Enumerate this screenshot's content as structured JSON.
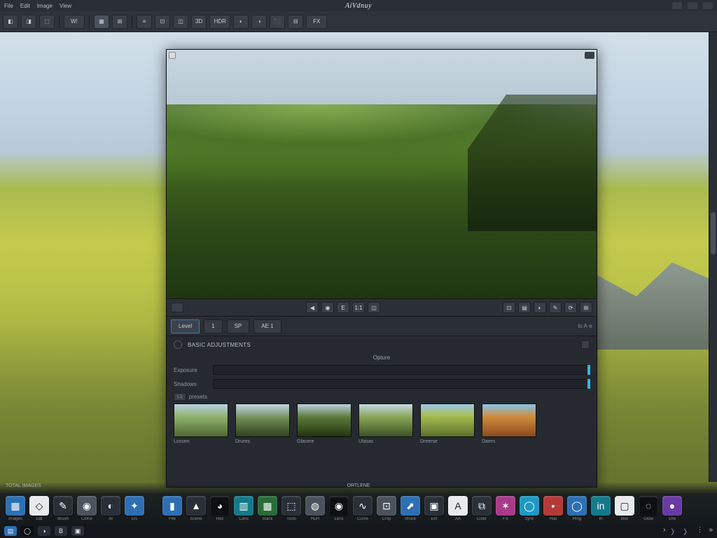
{
  "app": {
    "title": "AiVdnuy"
  },
  "menu": {
    "items": [
      "File",
      "Edit",
      "Image",
      "View"
    ]
  },
  "toolbar": {
    "buttons": [
      "◧",
      "◨",
      "⬚",
      "W!",
      "▦",
      "⊞",
      "≡",
      "⊡",
      "◫",
      "3D",
      "HDR",
      "◐",
      "◑",
      "⬛",
      "⊟",
      "FX"
    ]
  },
  "preview": {
    "search_icon": "search-icon",
    "close_icon": "close-icon"
  },
  "controlbar": {
    "left_indicator": "histogram-icon",
    "center": [
      "◀",
      "◉",
      "E",
      "1:1",
      "◫"
    ],
    "right": [
      "⊡",
      "▤",
      "◐",
      "✎",
      "⟳",
      "⊞"
    ]
  },
  "tabs": {
    "items": [
      "Level",
      "1",
      "SP",
      "AE 1"
    ],
    "active": 0,
    "right_label": "lo A·e"
  },
  "panel": {
    "title": "BASIC ADJUSTMENTS",
    "subhead": "Opture",
    "sliders": [
      {
        "label": "Exposure"
      },
      {
        "label": "Shadows"
      }
    ],
    "presets_label": "L1",
    "presets_tag": "presets",
    "presets": [
      {
        "label": "Lossen",
        "class": "t1"
      },
      {
        "label": "Drures",
        "class": "t2"
      },
      {
        "label": "Glasere",
        "class": "t3"
      },
      {
        "label": "Ulasas",
        "class": "t4"
      },
      {
        "label": "Dreerse",
        "class": "t5"
      },
      {
        "label": "Daern",
        "class": "t6"
      }
    ]
  },
  "dock": {
    "label_left": "TOTAL IMAGES",
    "label_center": "ORTLENE",
    "group_left": [
      {
        "name": "Images",
        "color": "c-blue",
        "glyph": "▦"
      },
      {
        "name": "Dat",
        "color": "c-white",
        "glyph": "◇"
      },
      {
        "name": "Brush",
        "color": "c-dark",
        "glyph": "✎"
      },
      {
        "name": "Clone",
        "color": "c-grey",
        "glyph": "◉"
      },
      {
        "name": "Al",
        "color": "c-dark",
        "glyph": "◐"
      },
      {
        "name": "Lrs",
        "color": "c-blue",
        "glyph": "✦"
      }
    ],
    "group_right": [
      {
        "name": "File",
        "color": "c-blue",
        "glyph": "▮"
      },
      {
        "name": "Scene",
        "color": "c-dark",
        "glyph": "▲"
      },
      {
        "name": "Rec",
        "color": "c-black",
        "glyph": "◕"
      },
      {
        "name": "Cans",
        "color": "c-teal",
        "glyph": "▥"
      },
      {
        "name": "Stack",
        "color": "c-green",
        "glyph": "▦"
      },
      {
        "name": "Tools",
        "color": "c-dark",
        "glyph": "⬚"
      },
      {
        "name": "HDR",
        "color": "c-grey",
        "glyph": "◍"
      },
      {
        "name": "Lens",
        "color": "c-black",
        "glyph": "◉"
      },
      {
        "name": "Curve",
        "color": "c-dark",
        "glyph": "∿"
      },
      {
        "name": "Crop",
        "color": "c-grey",
        "glyph": "⊡"
      },
      {
        "name": "Share",
        "color": "c-blue",
        "glyph": "⬈"
      },
      {
        "name": "Ext",
        "color": "c-dark",
        "glyph": "▣"
      },
      {
        "name": "AA",
        "color": "c-white",
        "glyph": "A"
      },
      {
        "name": "Color",
        "color": "c-dark",
        "glyph": "⧉"
      },
      {
        "name": "FX",
        "color": "c-mag",
        "glyph": "✶"
      },
      {
        "name": "Sync",
        "color": "c-cyan",
        "glyph": "◯"
      },
      {
        "name": "Hue",
        "color": "c-red",
        "glyph": "▪"
      },
      {
        "name": "Ring",
        "color": "c-blue",
        "glyph": "◯"
      },
      {
        "name": "In",
        "color": "c-teal",
        "glyph": "in"
      },
      {
        "name": "Box",
        "color": "c-white",
        "glyph": "▢"
      },
      {
        "name": "Glow",
        "color": "c-black",
        "glyph": "◌"
      },
      {
        "name": "Orb",
        "color": "c-pur",
        "glyph": "●"
      }
    ]
  },
  "tray": {
    "left": [
      {
        "color": "c-blue",
        "glyph": "▤"
      },
      {
        "color": "c-black",
        "glyph": "◯"
      },
      {
        "color": "c-dark",
        "glyph": "◑"
      },
      {
        "color": "c-dark",
        "glyph": "B"
      },
      {
        "color": "c-dark",
        "glyph": "▣"
      }
    ],
    "nav": [
      "›",
      "〉",
      "〉",
      "⋮",
      "»"
    ]
  }
}
